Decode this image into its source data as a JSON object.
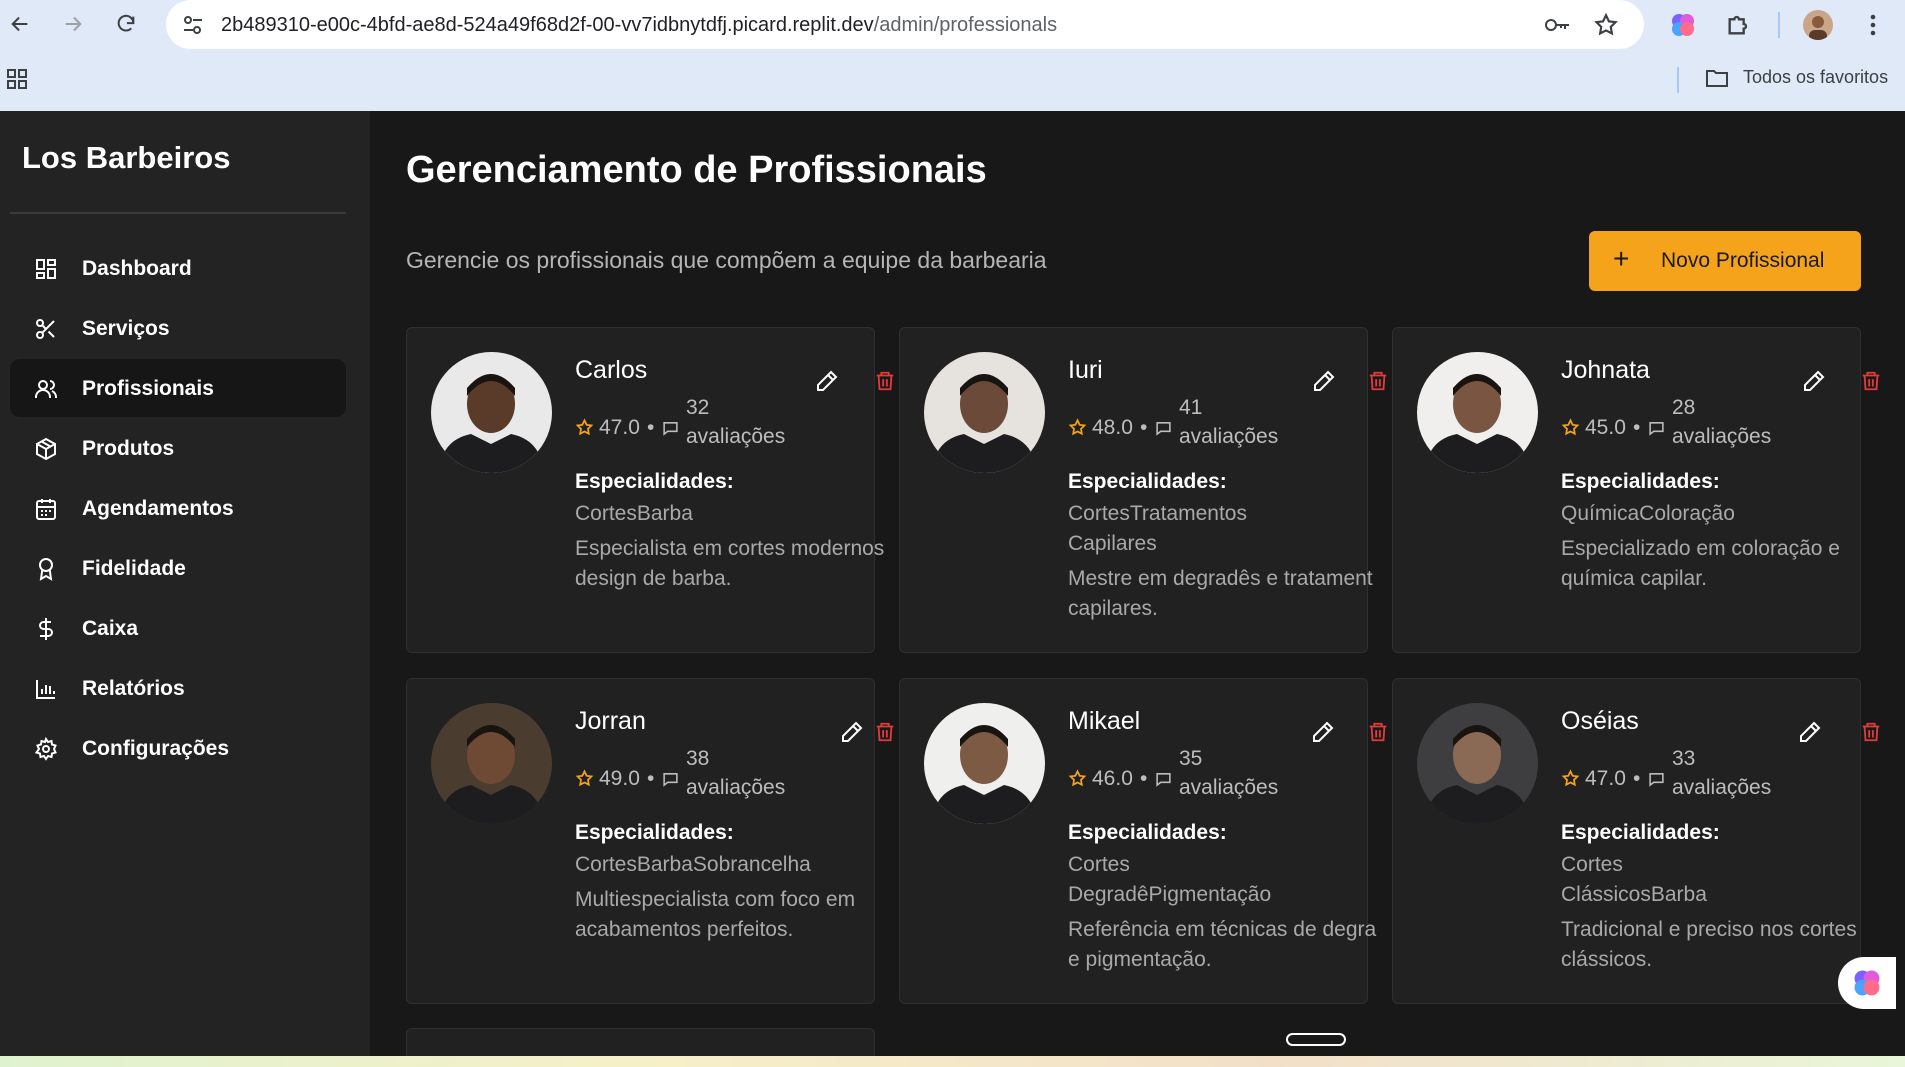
{
  "browser": {
    "url_host": "2b489310-e00c-4bfd-ae8d-524a49f68d2f-00-vv7idbnytdfj.picard.replit.dev",
    "url_path": "/admin/professionals",
    "bookmarks_folder": "Todos os favoritos"
  },
  "sidebar": {
    "brand": "Los Barbeiros",
    "items": [
      {
        "label": "Dashboard",
        "icon": "dashboard-icon",
        "active": false
      },
      {
        "label": "Serviços",
        "icon": "scissors-icon",
        "active": false
      },
      {
        "label": "Profissionais",
        "icon": "users-icon",
        "active": true
      },
      {
        "label": "Produtos",
        "icon": "package-icon",
        "active": false
      },
      {
        "label": "Agendamentos",
        "icon": "calendar-icon",
        "active": false
      },
      {
        "label": "Fidelidade",
        "icon": "award-icon",
        "active": false
      },
      {
        "label": "Caixa",
        "icon": "dollar-icon",
        "active": false
      },
      {
        "label": "Relatórios",
        "icon": "bar-chart-icon",
        "active": false
      },
      {
        "label": "Configurações",
        "icon": "gear-icon",
        "active": false
      }
    ]
  },
  "main": {
    "title": "Gerenciamento de Profissionais",
    "subtitle": "Gerencie os profissionais que compõem a equipe da barbearia",
    "new_button": "Novo Profissional",
    "specialties_label": "Especialidades:",
    "reviews_word": "avaliações",
    "professionals": [
      {
        "name": "Carlos",
        "rating": "47.0",
        "reviews": "32",
        "specialties": [
          "CortesBarba"
        ],
        "description": [
          "Especialista em cortes modernos",
          "design de barba."
        ]
      },
      {
        "name": "Iuri",
        "rating": "48.0",
        "reviews": "41",
        "specialties": [
          "CortesTratamentos",
          "Capilares"
        ],
        "description": [
          "Mestre em degradês e tratament",
          "capilares."
        ]
      },
      {
        "name": "Johnata",
        "rating": "45.0",
        "reviews": "28",
        "specialties": [
          "QuímicaColoração"
        ],
        "description": [
          "Especializado em coloração e",
          "química capilar."
        ]
      },
      {
        "name": "Jorran",
        "rating": "49.0",
        "reviews": "38",
        "specialties": [
          "CortesBarbaSobrancelha"
        ],
        "description": [
          "Multiespecialista com foco em",
          "acabamentos perfeitos."
        ]
      },
      {
        "name": "Mikael",
        "rating": "46.0",
        "reviews": "35",
        "specialties": [
          "Cortes",
          "DegradêPigmentação"
        ],
        "description": [
          "Referência em técnicas de degra",
          "e pigmentação."
        ]
      },
      {
        "name": "Oséias",
        "rating": "47.0",
        "reviews": "33",
        "specialties": [
          "Cortes",
          "ClássicosBarba"
        ],
        "description": [
          "Tradicional e preciso nos cortes",
          "clássicos."
        ]
      }
    ]
  },
  "colors": {
    "accent": "#f5a31a",
    "star": "#f5a31a",
    "danger": "#e23b3b",
    "background": "#181818",
    "card": "#212121"
  }
}
